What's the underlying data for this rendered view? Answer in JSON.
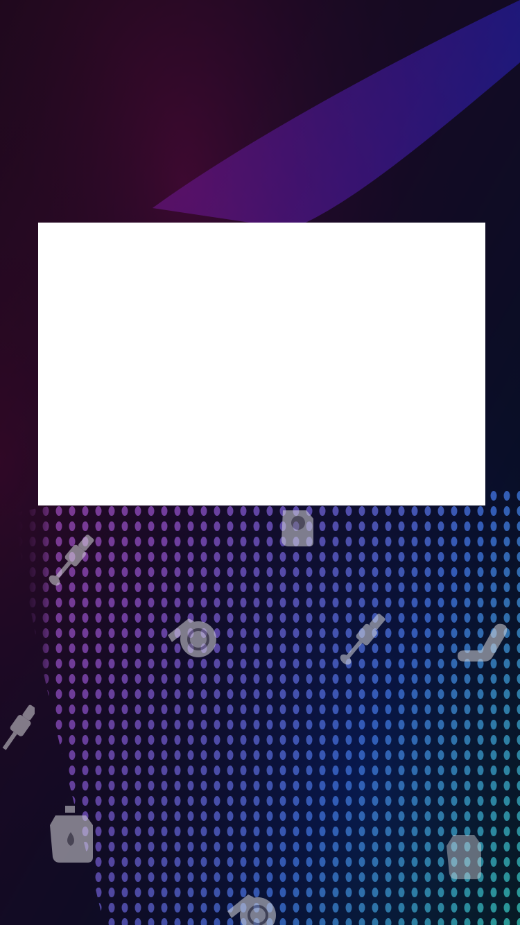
{
  "screen": {
    "name": "splash-screen",
    "panel_state": "blank-white-panel"
  },
  "colors": {
    "background_dark": "#25202e",
    "accent_magenta": "#c0409a",
    "accent_purple": "#7a4fc0",
    "accent_blue": "#3a6ad0",
    "accent_teal": "#2fb3a8",
    "panel": "#ffffff",
    "icon_tint": "#d8d8dc"
  },
  "decorative_icons": [
    "oil-can-icon",
    "spark-plug-icon",
    "wrench-wheel-icon",
    "spark-plug-icon",
    "car-seat-icon",
    "spark-plug-icon",
    "oil-can-icon",
    "wrench-wheel-icon",
    "oil-can-icon"
  ]
}
